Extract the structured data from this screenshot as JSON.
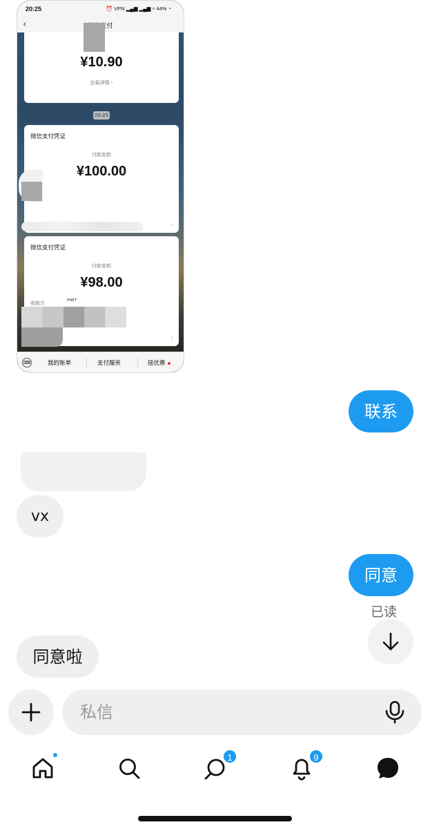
{
  "shared_image": {
    "status_time": "20:25",
    "status_icons": "⏰ VPN ▂▄▆ ▂▄▆ ▿ 44% ◔",
    "nav_title": "微信支付",
    "cards": [
      {
        "amount": "¥10.90",
        "link": "交易详情 ›"
      },
      {
        "title": "微信支付凭证",
        "label": "付款金额",
        "amount": "¥100.00"
      },
      {
        "title": "微信支付凭证",
        "label": "付款金额",
        "amount": "¥98.00",
        "payee_label": "收款方",
        "payee_logo": "PNET"
      }
    ],
    "time_chip": "20:25",
    "tabbar": [
      "我的账单",
      "支付服务",
      "摇优惠"
    ]
  },
  "messages": [
    {
      "direction": "out",
      "text": "联系"
    },
    {
      "direction": "in",
      "text": "vx"
    },
    {
      "direction": "out",
      "text": "同意"
    },
    {
      "direction": "in",
      "text": "同意啦"
    }
  ],
  "read_receipt": "已读",
  "composer": {
    "placeholder": "私信"
  },
  "bottom_nav": {
    "messages_badge": "1",
    "notifications_badge": "9"
  },
  "colors": {
    "accent": "#1d9bf0",
    "incoming_bubble": "#efefef"
  }
}
